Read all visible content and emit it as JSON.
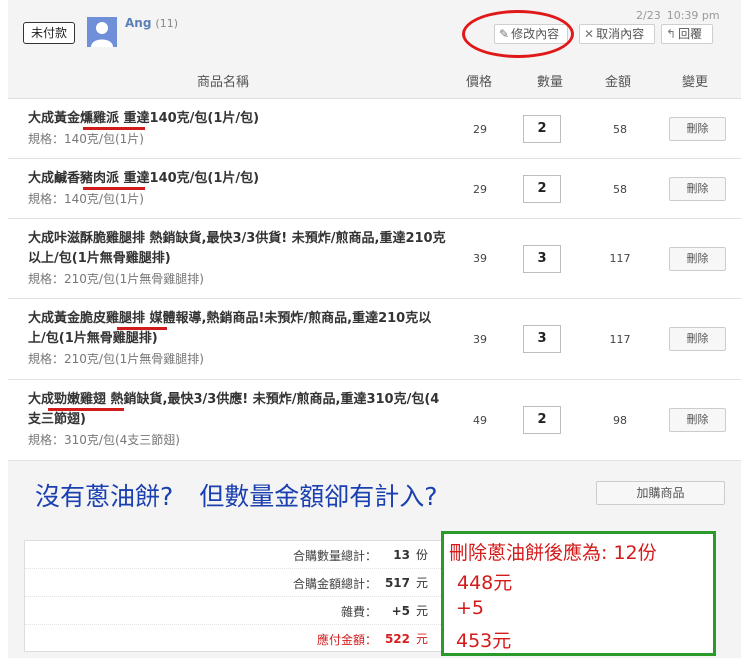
{
  "header": {
    "status": "未付款",
    "username": "Ang",
    "user_count": "(11)",
    "date": "2/23",
    "time": "10:39 pm",
    "edit_label": "修改內容",
    "cancel_label": "取消內容",
    "reply_label": "回覆"
  },
  "table": {
    "columns": [
      "商品名稱",
      "價格",
      "數量",
      "金額",
      "變更"
    ],
    "rows": [
      {
        "title": "大成黃金燻雞派 重達140克/包(1片/包)",
        "spec": "規格：140克/包(1片)",
        "price": "29",
        "qty": "2",
        "amount": "58",
        "action": "刪除"
      },
      {
        "title": "大成鹹香豬肉派 重達140克/包(1片/包)",
        "spec": "規格：140克/包(1片)",
        "price": "29",
        "qty": "2",
        "amount": "58",
        "action": "刪除"
      },
      {
        "title": "大成咔滋酥脆雞腿排 熱銷缺貨,最快3/3供貨! 未預炸/煎商品,重達210克以上/包(1片無骨雞腿排)",
        "spec": "規格：210克/包(1片無骨雞腿排)",
        "price": "39",
        "qty": "3",
        "amount": "117",
        "action": "刪除"
      },
      {
        "title": "大成黃金脆皮雞腿排 媒體報導,熱銷商品!未預炸/煎商品,重達210克以上/包(1片無骨雞腿排)",
        "spec": "規格：210克/包(1片無骨雞腿排)",
        "price": "39",
        "qty": "3",
        "amount": "117",
        "action": "刪除"
      },
      {
        "title": "大成勁嫩雞翅 熱銷缺貨,最快3/3供應! 未預炸/煎商品,重達310克/包(4支三節翅)",
        "spec": "規格：310克/包(4支三節翅)",
        "price": "49",
        "qty": "2",
        "amount": "98",
        "action": "刪除"
      }
    ]
  },
  "annotation": {
    "question_part1": "沒有蔥油餅?",
    "question_part2": "但數量金額卻有計入?",
    "note_qty": "刪除蔥油餅後應為: 12份",
    "note_total": "448元",
    "note_fee": "+5",
    "note_due": "453元"
  },
  "addon_label": "加購商品",
  "summary": {
    "qty_label": "合購數量總計：",
    "qty_value": "13",
    "qty_unit": "份",
    "total_label": "合購金額總計：",
    "total_value": "517",
    "total_unit": "元",
    "fee_label": "雜費：",
    "fee_value": "+5",
    "fee_unit": "元",
    "due_label": "應付金額：",
    "due_value": "522",
    "due_unit": "元"
  },
  "colors": {
    "annotation_red": "#d21c1c",
    "annotation_green": "#2a9a2a",
    "question_blue": "#1a3fb0",
    "username_blue": "#5b7fb8"
  }
}
